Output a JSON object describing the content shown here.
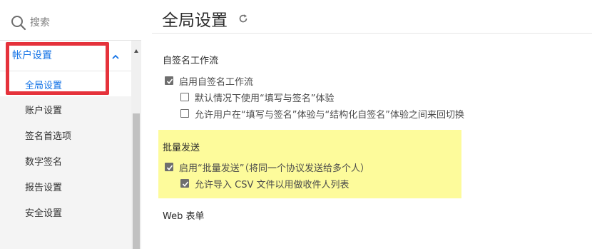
{
  "search": {
    "placeholder": "搜索"
  },
  "sidebar": {
    "group_label": "帐户设置",
    "items": [
      {
        "label": "全局设置",
        "selected": true
      },
      {
        "label": "账户设置",
        "selected": false
      },
      {
        "label": "签名首选项",
        "selected": false
      },
      {
        "label": "数字签名",
        "selected": false
      },
      {
        "label": "报告设置",
        "selected": false
      },
      {
        "label": "安全设置",
        "selected": false
      }
    ]
  },
  "main": {
    "title": "全局设置",
    "sections": {
      "self_sign": {
        "heading": "自签名工作流",
        "enable": {
          "label": "启用自签名工作流",
          "checked": true
        },
        "default_fill_sign": {
          "label": "默认情况下使用“填写与签名”体验",
          "checked": false
        },
        "allow_switch": {
          "label": "允许用户在“填写与签名”体验与“结构化自签名”体验之间来回切换",
          "checked": false
        }
      },
      "bulk_send": {
        "heading": "批量发送",
        "enable": {
          "label": "启用“批量发送”（将同一个协议发送给多个人）",
          "checked": true
        },
        "allow_csv": {
          "label": "允许导入 CSV 文件以用做收件人列表",
          "checked": true
        }
      },
      "web_form": {
        "heading": "Web 表单"
      }
    }
  },
  "colors": {
    "accent": "#1473e6",
    "annotation_red": "#e5323b",
    "highlight_yellow": "#fdfb9b",
    "checkbox_gray": "#6e6e6e"
  },
  "icons": {
    "search": "search-icon",
    "chevron": "chevron-up-icon",
    "refresh": "refresh-icon",
    "scroll_up": "scroll-up-arrow-icon"
  }
}
